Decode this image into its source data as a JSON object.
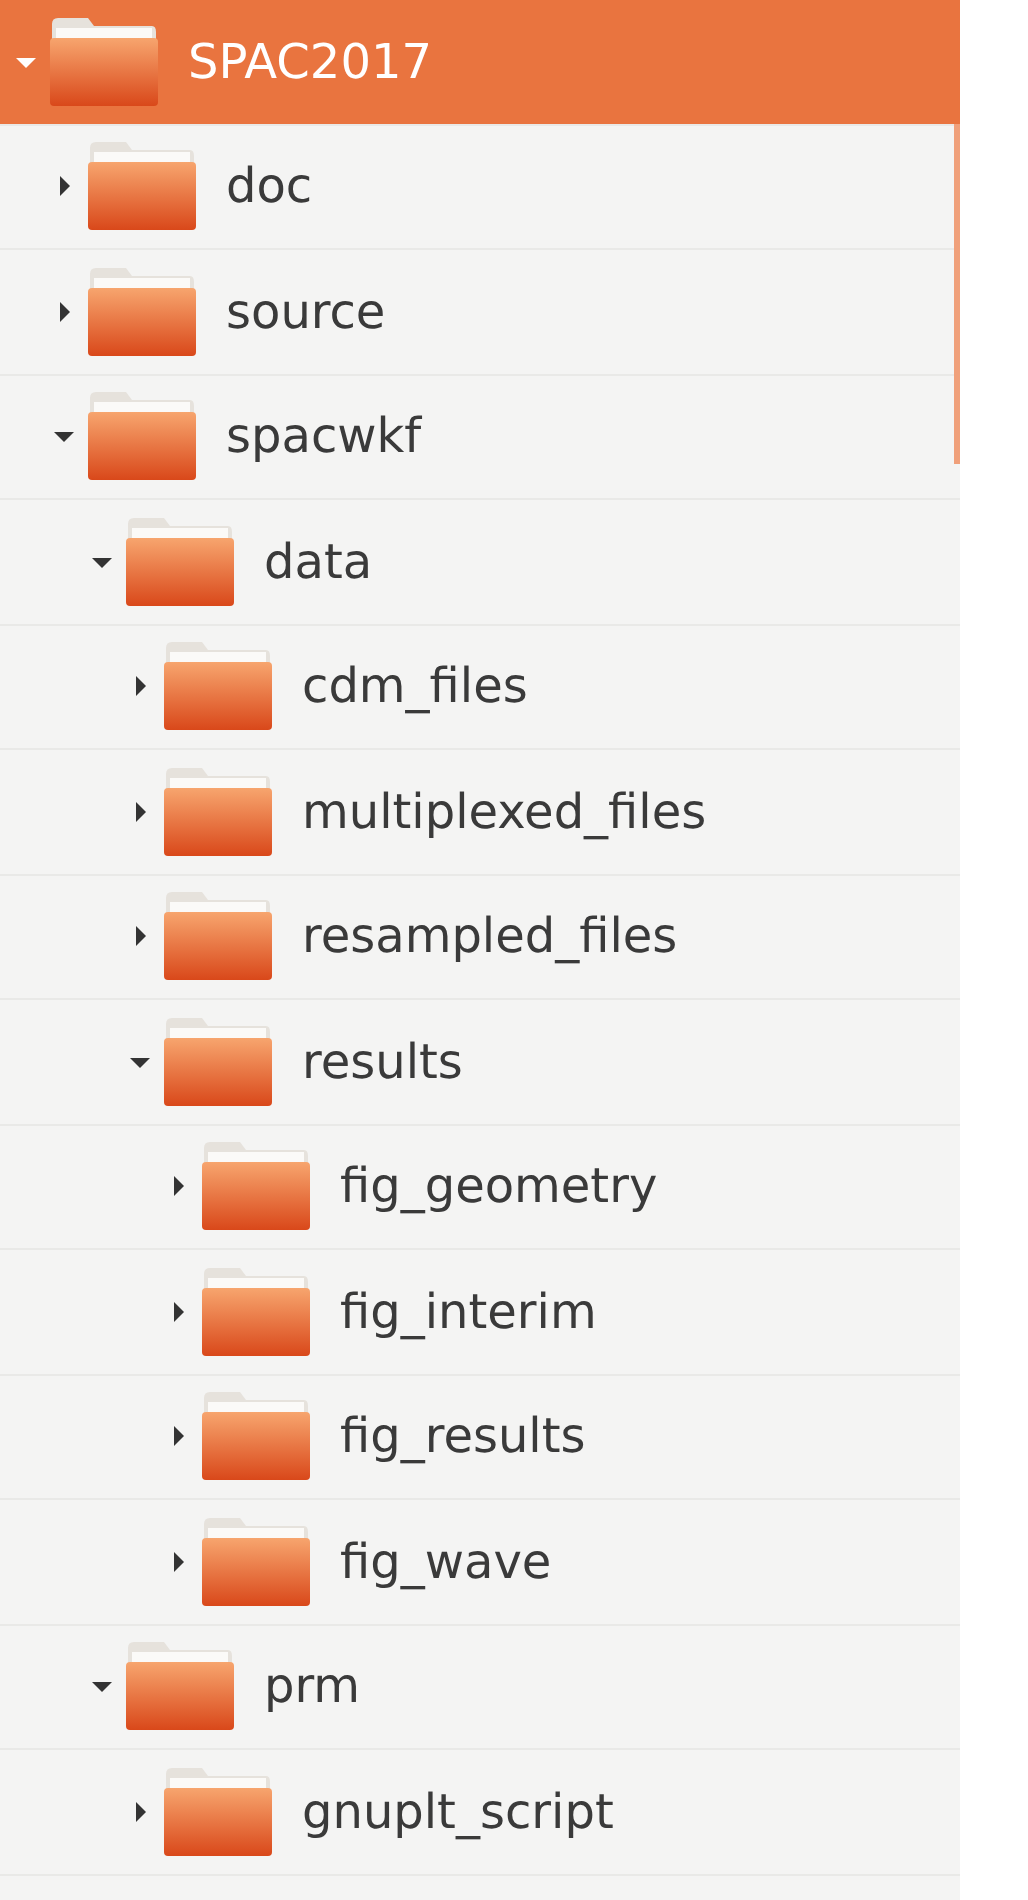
{
  "tree": [
    {
      "name": "SPAC2017",
      "selected": true,
      "expanded": true,
      "children": [
        {
          "name": "doc",
          "selected": false,
          "expanded": false
        },
        {
          "name": "source",
          "selected": false,
          "expanded": false
        },
        {
          "name": "spacwkf",
          "selected": false,
          "expanded": true,
          "children": [
            {
              "name": "data",
              "selected": false,
              "expanded": true,
              "children": [
                {
                  "name": "cdm_files",
                  "selected": false,
                  "expanded": false
                },
                {
                  "name": "multiplexed_files",
                  "selected": false,
                  "expanded": false
                },
                {
                  "name": "resampled_files",
                  "selected": false,
                  "expanded": false
                },
                {
                  "name": "results",
                  "selected": false,
                  "expanded": true,
                  "children": [
                    {
                      "name": "fig_geometry",
                      "selected": false,
                      "expanded": false
                    },
                    {
                      "name": "fig_interim",
                      "selected": false,
                      "expanded": false
                    },
                    {
                      "name": "fig_results",
                      "selected": false,
                      "expanded": false
                    },
                    {
                      "name": "fig_wave",
                      "selected": false,
                      "expanded": false
                    }
                  ]
                }
              ]
            },
            {
              "name": "prm",
              "selected": false,
              "expanded": true,
              "children": [
                {
                  "name": "gnuplt_script",
                  "selected": false,
                  "expanded": false
                }
              ]
            }
          ]
        }
      ]
    }
  ]
}
